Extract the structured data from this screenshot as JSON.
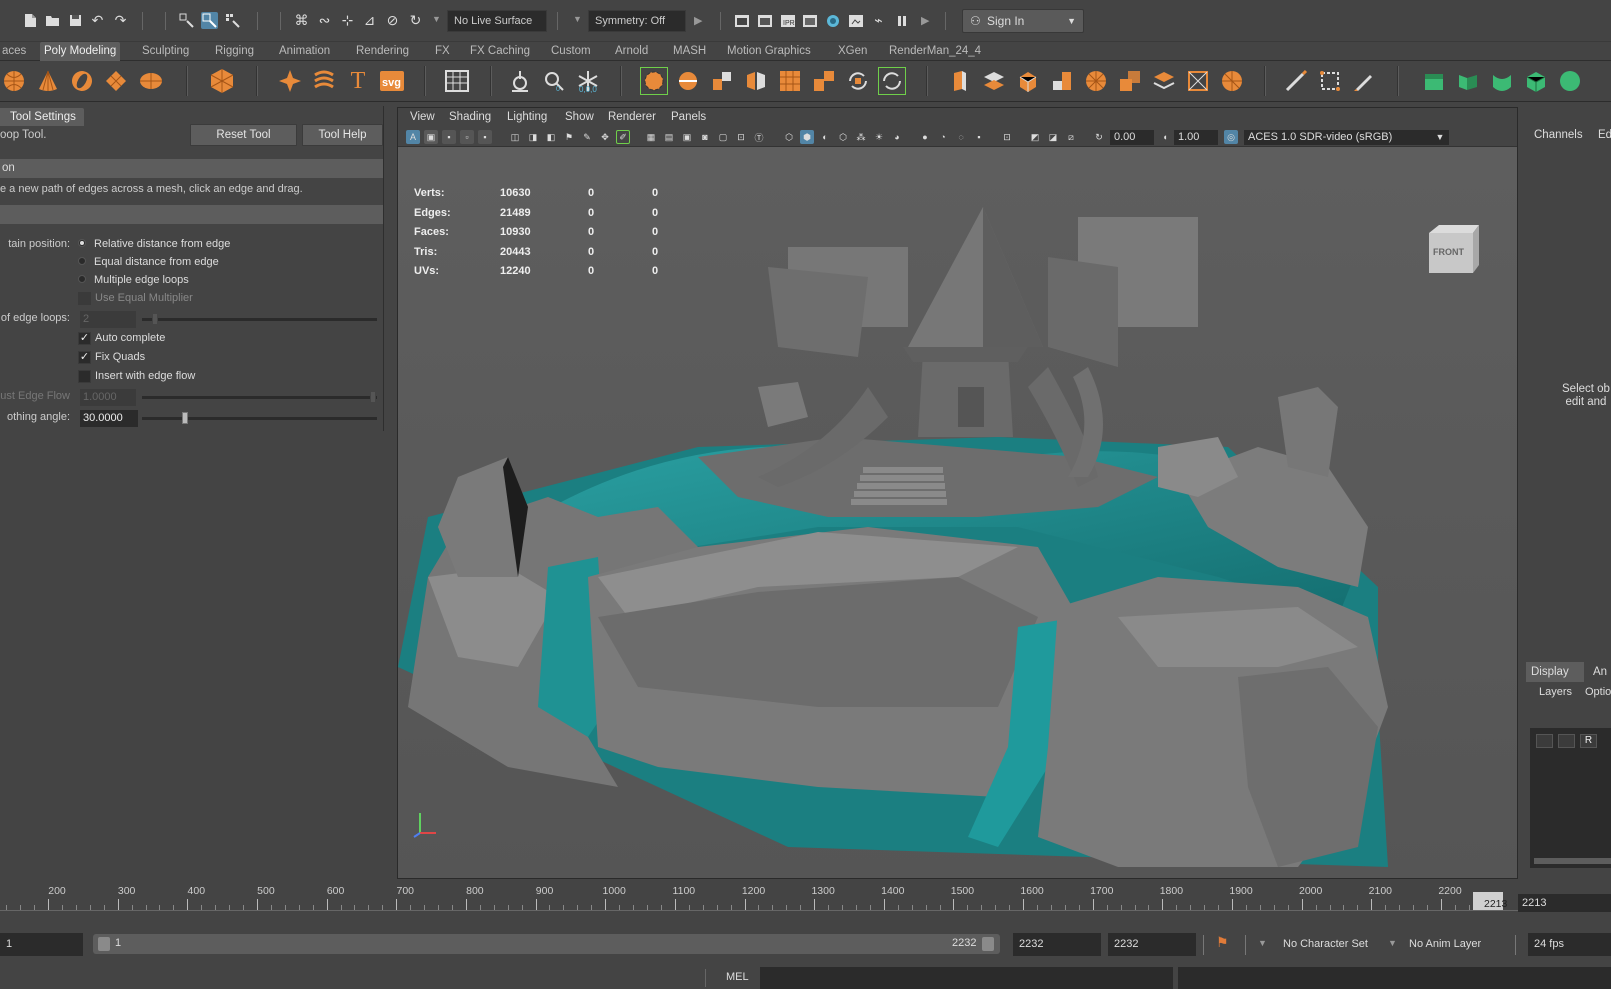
{
  "statusline": {
    "live_surface": "No Live Surface",
    "symmetry": "Symmetry: Off",
    "sign_in": "Sign In"
  },
  "shelf_tabs": [
    "aces",
    "Poly Modeling",
    "Sculpting",
    "Rigging",
    "Animation",
    "Rendering",
    "FX",
    "FX Caching",
    "Custom",
    "Arnold",
    "MASH",
    "Motion Graphics",
    "XGen",
    "RenderMan_24_4"
  ],
  "shelf_active_tab": "Poly Modeling",
  "shelf_icons": [
    "poly-sphere",
    "poly-cone",
    "poly-torus",
    "poly-plane",
    "poly-disk",
    "platonic-solid",
    "sweep-mesh",
    "type-text",
    "svg",
    "poly-count",
    "combine",
    "separate",
    "mirror",
    "smooth",
    "extrude",
    "bevel",
    "bridge",
    "fill-hole",
    "multi-cut",
    "target-weld",
    "connect",
    "quad-draw"
  ],
  "tool_settings": {
    "header": "Tool Settings",
    "tool_name": "oop Tool.",
    "reset_label": "Reset Tool",
    "help_label": "Tool Help",
    "section_description": "on",
    "description": "e a new path of edges across a mesh, click an edge and drag.",
    "section_settings": "",
    "maintain_label": "tain position:",
    "radio_options": [
      "Relative distance from edge",
      "Equal distance from edge",
      "Multiple edge loops"
    ],
    "radio_selected": 0,
    "use_equal_multiplier": "Use Equal Multiplier",
    "edge_loops_label": "of edge loops:",
    "edge_loops_value": "2",
    "auto_complete": "Auto complete",
    "fix_quads": "Fix Quads",
    "insert_edge_flow": "Insert with edge flow",
    "adjust_edge_flow_label": "ust Edge Flow",
    "adjust_edge_flow_value": "1.0000",
    "smoothing_label": "othing angle:",
    "smoothing_value": "30.0000",
    "smoothing_fraction": 0.17
  },
  "viewport": {
    "menu": [
      "View",
      "Shading",
      "Lighting",
      "Show",
      "Renderer",
      "Panels"
    ],
    "exposure": "0.00",
    "gamma": "1.00",
    "color_space": "ACES 1.0 SDR-video (sRGB)",
    "camera": "persp",
    "view_cube_label": "FRONT",
    "hud": [
      {
        "label": "Verts:",
        "a": "10630",
        "b": "0",
        "c": "0"
      },
      {
        "label": "Edges:",
        "a": "21489",
        "b": "0",
        "c": "0"
      },
      {
        "label": "Faces:",
        "a": "10930",
        "b": "0",
        "c": "0"
      },
      {
        "label": "Tris:",
        "a": "20443",
        "b": "0",
        "c": "0"
      },
      {
        "label": "UVs:",
        "a": "12240",
        "b": "0",
        "c": "0"
      }
    ],
    "colors": {
      "water": "#1d8a8c",
      "rock": "#7a7a7a",
      "background": "#595959"
    }
  },
  "channel_box": {
    "tabs": [
      "Channels",
      "Ed"
    ],
    "message_line1": "Select ob",
    "message_line2": "edit and"
  },
  "layer_editor": {
    "tabs": [
      "Display",
      "An"
    ],
    "sub": [
      "Layers",
      "Optio"
    ],
    "btn_r": "R"
  },
  "time_slider": {
    "ticks": [
      "200",
      "300",
      "400",
      "500",
      "600",
      "700",
      "800",
      "900",
      "1000",
      "1100",
      "1200",
      "1300",
      "1400",
      "1500",
      "1600",
      "1700",
      "1800",
      "1900",
      "2000",
      "2100",
      "2200"
    ],
    "current_frame": "2213",
    "current_field": "2213"
  },
  "range": {
    "start": "1",
    "range_start": "1",
    "range_end": "2232",
    "anim_end": "2232",
    "end": "2232",
    "character_set": "No Character Set",
    "anim_layer": "No Anim Layer",
    "fps": "24 fps"
  },
  "command_line": {
    "language": "MEL"
  }
}
